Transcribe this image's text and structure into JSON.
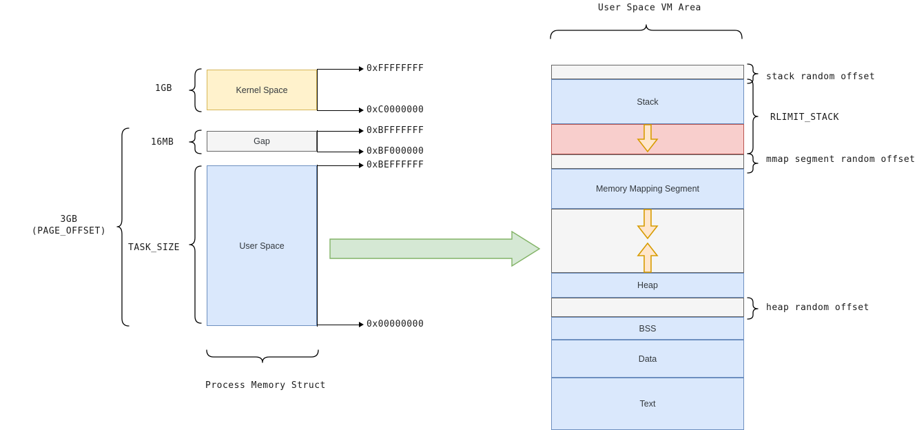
{
  "diagram": {
    "title_right": "User Space VM Area",
    "title_left": "Process Memory Struct"
  },
  "left_panel": {
    "size_labels": {
      "kernel": "1GB",
      "gap": "16MB",
      "total_line1": "3GB",
      "total_line2": "(PAGE_OFFSET)",
      "task_size": "TASK_SIZE"
    },
    "blocks": [
      {
        "name": "kernel-space",
        "label": "Kernel Space",
        "color": "#fff2cc",
        "border": "#d6b656"
      },
      {
        "name": "gap",
        "label": "Gap",
        "color": "#f5f5f5",
        "border": "#666666"
      },
      {
        "name": "user-space",
        "label": "User Space",
        "color": "#dae8fc",
        "border": "#6c8ebf"
      }
    ],
    "addresses": [
      "0xFFFFFFFF",
      "0xC0000000",
      "0xBFFFFFFF",
      "0xBF000000",
      "0xBEFFFFFF",
      "0x00000000"
    ]
  },
  "right_panel": {
    "blocks": [
      {
        "name": "stack-random-offset-region",
        "label": "",
        "color": "#f5f5f5",
        "border": "#666666"
      },
      {
        "name": "stack",
        "label": "Stack",
        "color": "#dae8fc",
        "border": "#6c8ebf"
      },
      {
        "name": "stack-growth-region",
        "label": "",
        "color": "#f8cecc",
        "border": "#b85450"
      },
      {
        "name": "mmap-random-offset-region",
        "label": "",
        "color": "#f5f5f5",
        "border": "#666666"
      },
      {
        "name": "memory-mapping-segment",
        "label": "Memory Mapping Segment",
        "color": "#dae8fc",
        "border": "#6c8ebf"
      },
      {
        "name": "free-growth-region",
        "label": "",
        "color": "#f5f5f5",
        "border": "#666666"
      },
      {
        "name": "heap",
        "label": "Heap",
        "color": "#dae8fc",
        "border": "#6c8ebf"
      },
      {
        "name": "heap-random-offset-region",
        "label": "",
        "color": "#f5f5f5",
        "border": "#666666"
      },
      {
        "name": "bss",
        "label": "BSS",
        "color": "#dae8fc",
        "border": "#6c8ebf"
      },
      {
        "name": "data",
        "label": "Data",
        "color": "#dae8fc",
        "border": "#6c8ebf"
      },
      {
        "name": "text",
        "label": "Text",
        "color": "#dae8fc",
        "border": "#6c8ebf"
      }
    ],
    "annotations": [
      "stack random offset",
      "RLIMIT_STACK",
      "mmap segment random offset",
      "heap random offset"
    ]
  },
  "colors": {
    "blue_fill": "#dae8fc",
    "blue_border": "#6c8ebf",
    "pink_fill": "#f8cecc",
    "pink_border": "#b85450",
    "yellow_fill": "#fff2cc",
    "yellow_border": "#d6b656",
    "gray_fill": "#f5f5f5",
    "gray_border": "#666666",
    "green_fill": "#d5e8d4",
    "green_border": "#82b366",
    "orange_fill": "#ffe6cc",
    "orange_border": "#d79b00",
    "text": "#1a1a1a"
  }
}
